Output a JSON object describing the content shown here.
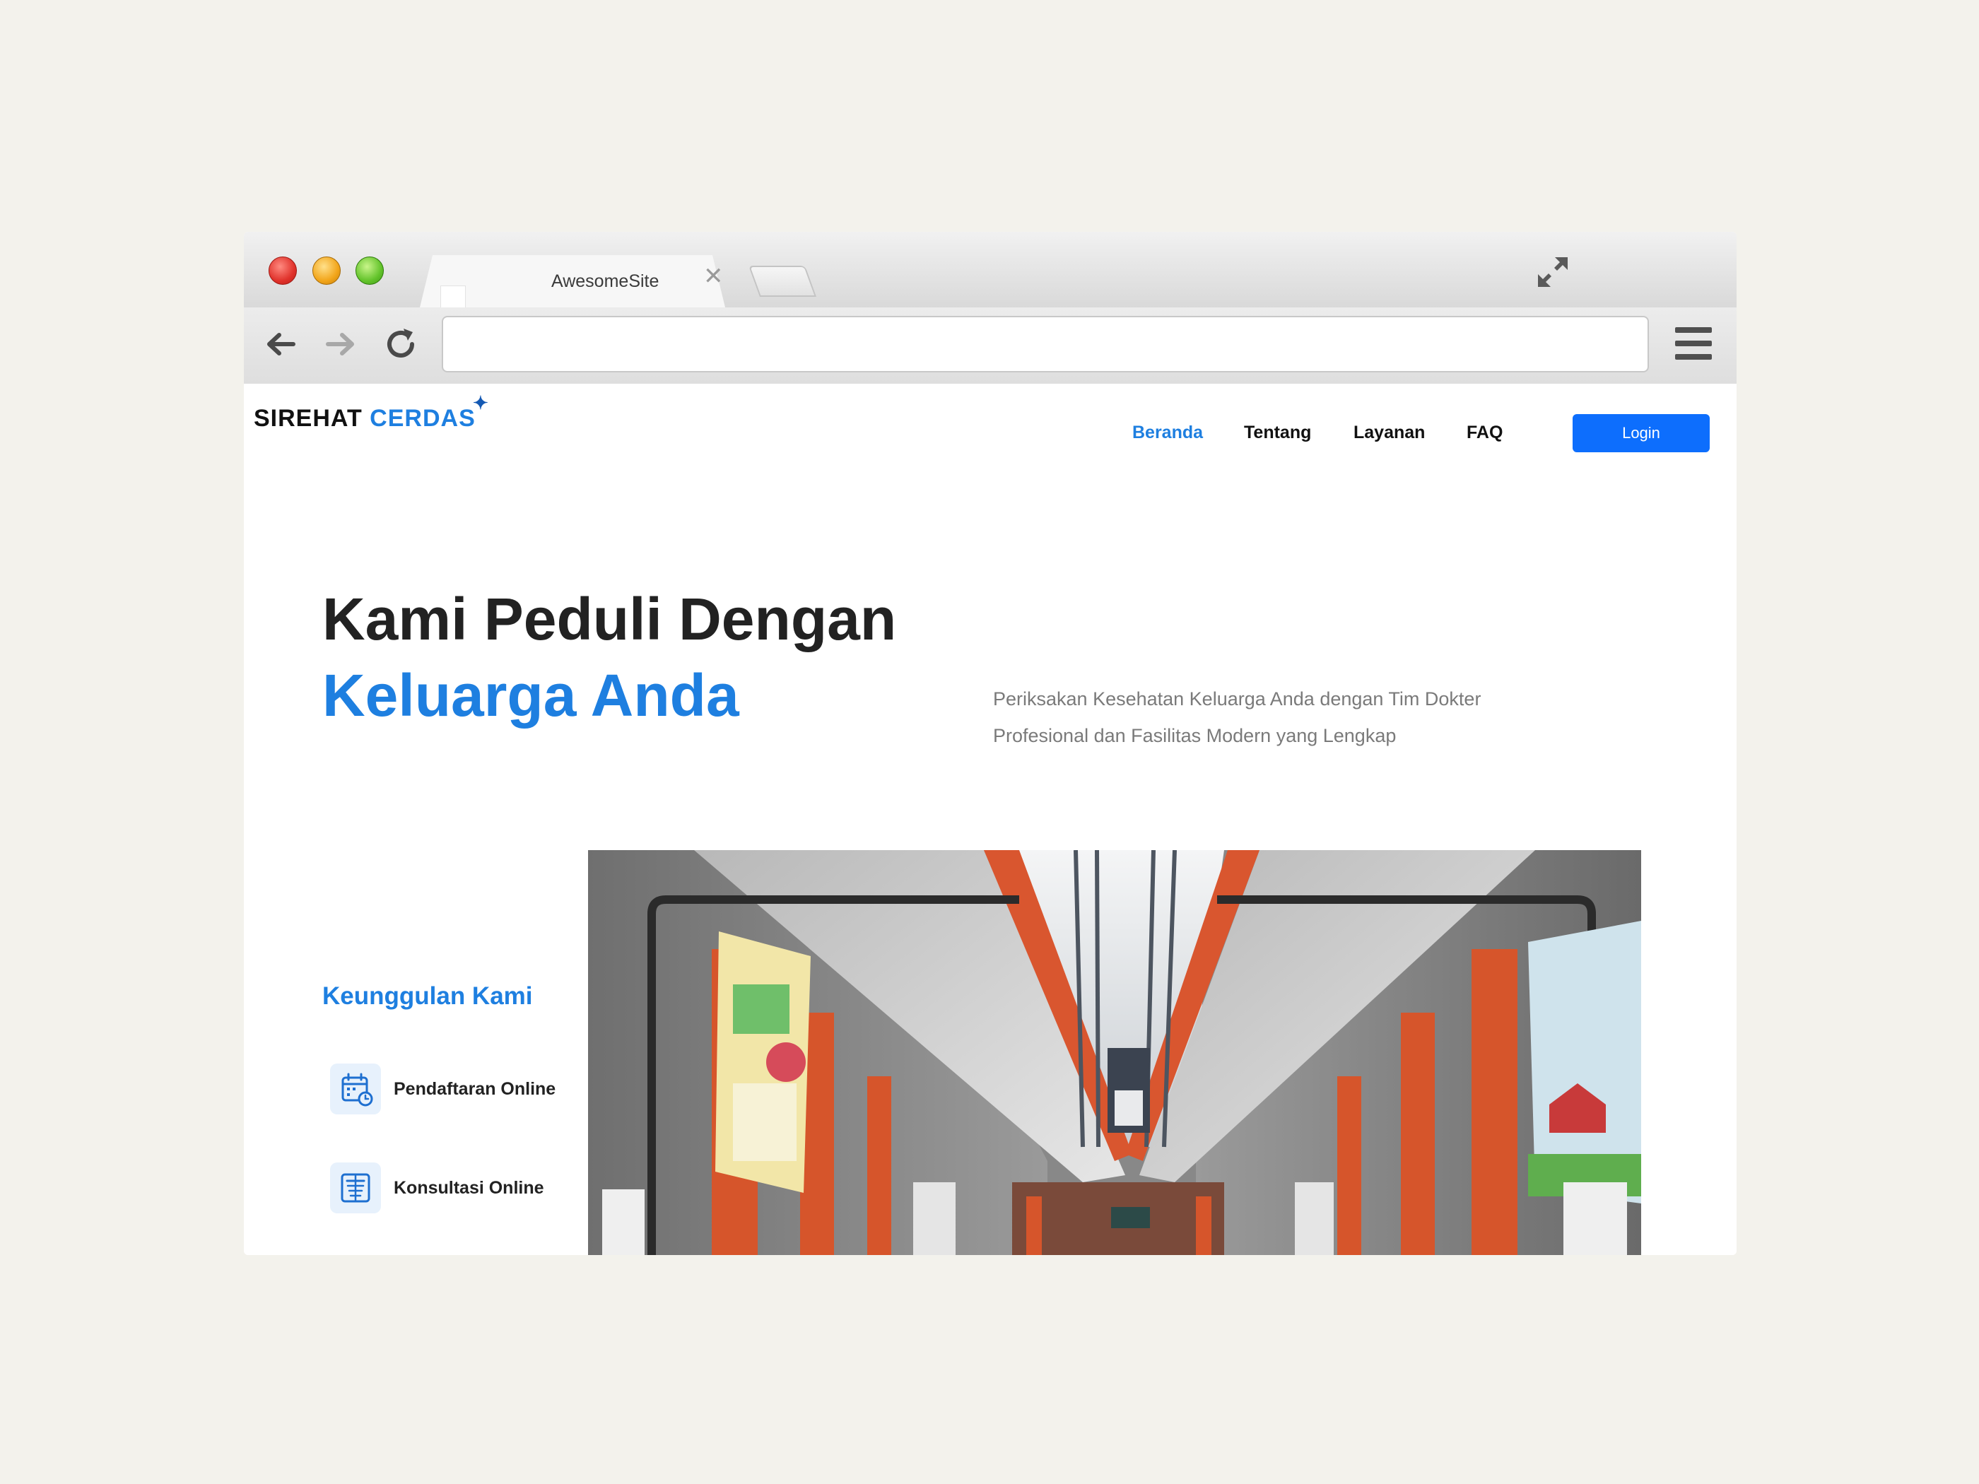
{
  "browser": {
    "tab_title": "AwesomeSite",
    "tab_close": "✕",
    "address": ""
  },
  "site": {
    "logo_part1": "SIREHAT",
    "logo_part2": "CERDAS",
    "logo_star": "✦",
    "nav": {
      "items": [
        {
          "label": "Beranda",
          "active": true
        },
        {
          "label": "Tentang",
          "active": false
        },
        {
          "label": "Layanan",
          "active": false
        },
        {
          "label": "FAQ",
          "active": false
        }
      ],
      "login_label": "Login"
    },
    "hero": {
      "line1": "Kami Peduli Dengan",
      "line2": "Keluarga Anda",
      "description": "Periksakan Kesehatan Keluarga Anda dengan Tim Dokter Profesional dan Fasilitas Modern yang Lengkap"
    },
    "advantages": {
      "title": "Keunggulan Kami",
      "items": [
        {
          "label": "Pendaftaran Online",
          "icon": "calendar-clock-icon"
        },
        {
          "label": "Konsultasi Online",
          "icon": "document-list-icon"
        }
      ]
    }
  },
  "colors": {
    "accent": "#1e7fe0",
    "login_button": "#0d6efd",
    "background": "#f3f2ec",
    "heading": "#222222",
    "muted_text": "#7a7a7a"
  }
}
